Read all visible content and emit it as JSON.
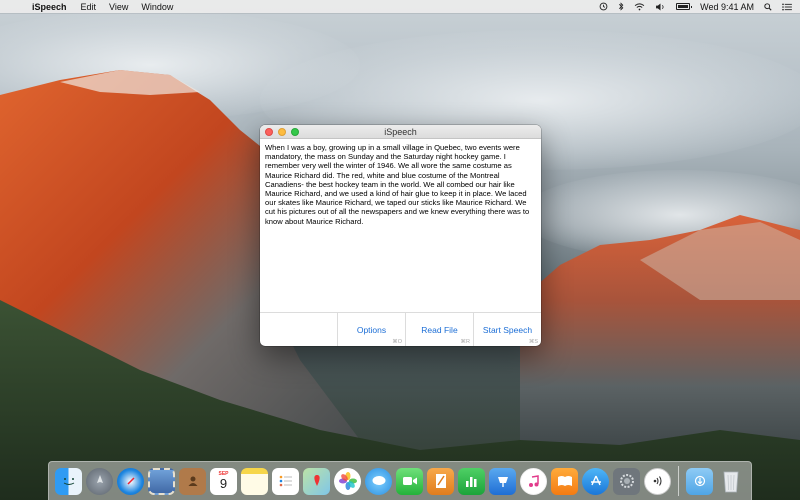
{
  "menubar": {
    "apple_icon": "apple-icon",
    "app_name": "iSpeech",
    "menus": [
      "Edit",
      "View",
      "Window"
    ],
    "status_icons": [
      "time-machine-icon",
      "bluetooth-icon",
      "wifi-icon",
      "volume-icon",
      "battery-icon"
    ],
    "clock": "Wed 9:41 AM",
    "spotlight_icon": "spotlight-icon",
    "notification_icon": "notification-center-icon"
  },
  "window": {
    "title": "iSpeech",
    "text": "When I was a boy, growing up in a small village in Quebec, two events were mandatory, the mass on Sunday and the Saturday night hockey game. I remember very well the winter of 1946. We all wore the same costume as Maurice Richard did. The red, white and blue costume of the Montreal Canadiens- the best hockey team in the world. We all combed our hair like Maurice Richard, and we used a kind of hair glue to keep it in place. We laced our skates like Maurice Richard, we taped our sticks like Maurice Richard. We cut his pictures out of all the newspapers and we knew everything there was to know about Maurice Richard.",
    "buttons": [
      {
        "label": "Options",
        "shortcut": "⌘O"
      },
      {
        "label": "Read File",
        "shortcut": "⌘R"
      },
      {
        "label": "Start Speech",
        "shortcut": "⌘S"
      }
    ]
  },
  "dock": {
    "calendar_month": "SEP",
    "calendar_day": "9",
    "apps": [
      "finder",
      "launchpad",
      "safari",
      "mail-photo",
      "contacts",
      "calendar",
      "notes",
      "reminders",
      "maps",
      "photos",
      "messages",
      "facetime",
      "pages",
      "numbers",
      "keynote",
      "itunes",
      "ibooks",
      "app-store",
      "system-preferences",
      "ispeech",
      "downloads",
      "trash"
    ]
  },
  "colors": {
    "accent": "#1c6ed6",
    "close": "#fc605c",
    "minimize": "#fdbc40",
    "maximize": "#34c84a"
  }
}
